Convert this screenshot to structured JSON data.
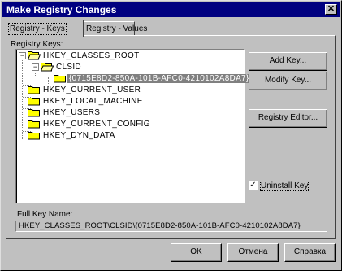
{
  "window": {
    "title": "Make Registry Changes"
  },
  "tabs": [
    {
      "label": "Registry - Keys",
      "active": true
    },
    {
      "label": "Registry - Values",
      "active": false
    }
  ],
  "tree": {
    "label": "Registry Keys:",
    "items": [
      {
        "text": "HKEY_CLASSES_ROOT",
        "expanded": true
      },
      {
        "text": "CLSID",
        "expanded": true
      },
      {
        "text": "{0715E8D2-850A-101B-AFC0-4210102A8DA7}",
        "selected": true
      },
      {
        "text": "HKEY_CURRENT_USER"
      },
      {
        "text": "HKEY_LOCAL_MACHINE"
      },
      {
        "text": "HKEY_USERS"
      },
      {
        "text": "HKEY_CURRENT_CONFIG"
      },
      {
        "text": "HKEY_DYN_DATA"
      }
    ]
  },
  "buttons": {
    "add_key": "Add Key...",
    "modify_key": "Modify Key...",
    "registry_editor": "Registry Editor...",
    "ok": "OK",
    "cancel": "Отмена",
    "help": "Справка"
  },
  "uninstall": {
    "label": "Uninstall Key",
    "checked": true,
    "mark": "✓"
  },
  "fullkey": {
    "label": "Full Key Name:",
    "value": "HKEY_CLASSES_ROOT\\CLSID\\{0715E8D2-850A-101B-AFC0-4210102A8DA7}"
  },
  "colors": {
    "titlebar": "#000080",
    "face": "#c0c0c0",
    "selection": "#808080",
    "folder": "#ffff00"
  },
  "icons": {
    "close": "close-icon",
    "folder": "folder-icon",
    "expand": "minus-icon"
  }
}
